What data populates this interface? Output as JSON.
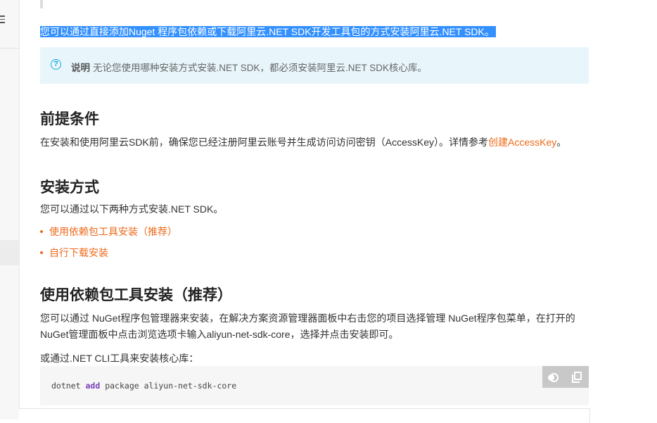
{
  "selected_text": "您可以通过直接添加Nuget 程序包依赖或下载阿里云.NET SDK开发工具包的方式安装阿里云.NET SDK。",
  "note": {
    "label": "说明",
    "text": "无论您使用哪种安装方式安装.NET SDK，都必须安装阿里云.NET SDK核心库。"
  },
  "sections": {
    "prereq": {
      "title": "前提条件",
      "text_before": "在安装和使用阿里云SDK前，确保您已经注册阿里云账号并生成访问访问密钥（AccessKey）。详情参考",
      "link": "创建AccessKey",
      "text_after": "。"
    },
    "install": {
      "title": "安装方式",
      "intro": "您可以通过以下两种方式安装.NET SDK。",
      "options": [
        "使用依赖包工具安装（推荐）",
        "自行下载安装"
      ]
    },
    "pkg_tool": {
      "title": "使用依赖包工具安装（推荐）",
      "para1_line1": "您可以通过 NuGet程序包管理器来安装，在解决方案资源管理器面板中右击您的项目选择管理 NuGet程序包菜单，在打开的",
      "para1_line2": "NuGet管理面板中点击浏览选项卡输入aliyun-net-sdk-core，选择并点击安装即可。",
      "para2": "或通过.NET CLI工具来安装核心库："
    }
  },
  "code": {
    "cmd": "dotnet",
    "keyword": "add",
    "rest": "package aliyun-net-sdk-core"
  },
  "icons": {
    "menu": "hamburger-menu-icon",
    "note": "question-circle-icon",
    "theme": "theme-toggle-icon",
    "copy": "copy-icon"
  },
  "colors": {
    "link": "#ed6a1b",
    "note_bg": "#e8f6fc",
    "note_icon": "#18a7d8",
    "selection": "#3390ff",
    "code_keyword": "#7b3fb8"
  }
}
